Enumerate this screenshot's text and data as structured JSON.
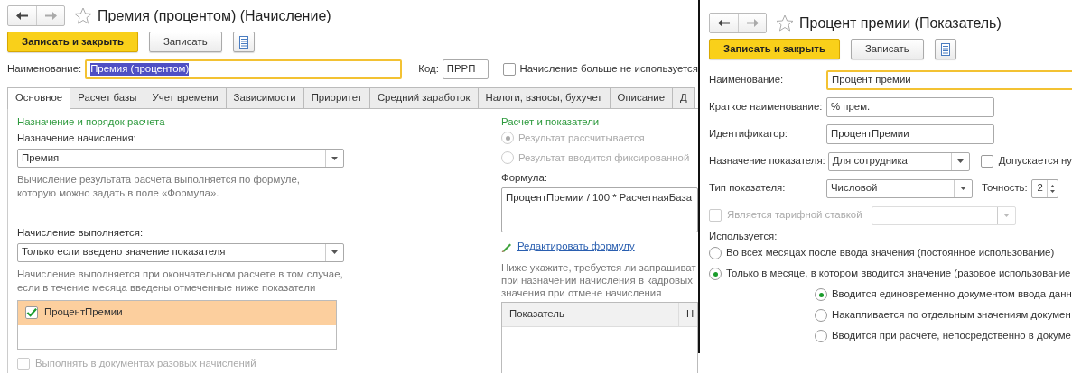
{
  "left_window": {
    "title": "Премия (процентом) (Начисление)",
    "favorite": false,
    "toolbar": [
      {
        "label": "Записать и закрыть",
        "kind": "primary"
      },
      {
        "label": "Записать",
        "kind": "default"
      },
      {
        "kind": "menu"
      }
    ],
    "name_field": {
      "label": "Наименование:",
      "value": "Премия (процентом)",
      "focused": true,
      "text_selected": true
    },
    "code_field": {
      "label": "Код:",
      "value": "ПРРП"
    },
    "discontinued": {
      "label": "Начисление больше не используется",
      "checked": false
    },
    "tabs": [
      {
        "label": "Основное",
        "selected": true
      },
      {
        "label": "Расчет базы",
        "selected": false
      },
      {
        "label": "Учет времени",
        "selected": false
      },
      {
        "label": "Зависимости",
        "selected": false
      },
      {
        "label": "Приоритет",
        "selected": false
      },
      {
        "label": "Средний заработок",
        "selected": false
      },
      {
        "label": "Налоги, взносы, бухучет",
        "selected": false
      },
      {
        "label": "Описание",
        "selected": false
      },
      {
        "label": "Д",
        "selected": false
      }
    ],
    "purpose_section": {
      "heading": "Назначение и порядок расчета",
      "purpose_label": "Назначение начисления:",
      "purpose_value": "Премия",
      "purpose_hint": [
        "Вычисление результата расчета выполняется по формуле,",
        "которую можно задать в поле «Формула»."
      ],
      "execution_label": "Начисление выполняется:",
      "execution_value": "Только если введено значение показателя",
      "execution_hint": [
        "Начисление выполняется при окончательном расчете в том случае,",
        "если в течение месяца введены отмеченные ниже показатели"
      ],
      "indicators": [
        {
          "label": "ПроцентПремии",
          "checked": true,
          "selected": true
        }
      ],
      "one_time": {
        "label": "Выполнять в документах разовых начислений",
        "checked": false,
        "disabled": true
      }
    },
    "calc_section": {
      "heading": "Расчет и показатели",
      "result_options": [
        {
          "label": "Результат рассчитывается",
          "selected": true,
          "disabled": true
        },
        {
          "label": "Результат вводится фиксированной",
          "selected": false,
          "disabled": true
        }
      ],
      "formula_label": "Формула:",
      "formula": "ПроцентПремии / 100 * РасчетнаяБаза",
      "edit_link": "Редактировать формулу",
      "request_hint": [
        "Ниже укажите, требуется ли запрашиват",
        "при назначении начисления в кадровых",
        "значения при отмене начисления"
      ],
      "table_columns": [
        "Показатель",
        "Н"
      ]
    }
  },
  "right_window": {
    "title": "Процент премии (Показатель)",
    "favorite": false,
    "toolbar": [
      {
        "label": "Записать и закрыть",
        "kind": "primary"
      },
      {
        "label": "Записать",
        "kind": "default"
      },
      {
        "kind": "menu"
      }
    ],
    "fields": [
      {
        "label": "Наименование:",
        "value": "Процент премии",
        "focused": true,
        "kind": "wide"
      },
      {
        "label": "Краткое наименование:",
        "value": "% прем.",
        "focused": false,
        "kind": "short"
      },
      {
        "label": "Идентификатор:",
        "value": "ПроцентПремии",
        "focused": false,
        "kind": "short"
      }
    ],
    "purpose": {
      "label": "Назначение показателя:",
      "value": "Для сотрудника"
    },
    "allow_zero": {
      "label": "Допускается ну",
      "checked": false
    },
    "type": {
      "label": "Тип показателя:",
      "value": "Числовой"
    },
    "precision": {
      "label": "Точность:",
      "value": "2"
    },
    "tariff": {
      "label": "Является тарифной ставкой",
      "checked": false,
      "disabled": true
    },
    "usage": {
      "label": "Используется:",
      "options": [
        {
          "label": "Во всех месяцах после ввода значения (постоянное использование)",
          "selected": false
        },
        {
          "label": "Только в месяце, в котором вводится значение (разовое использование",
          "selected": true,
          "children": [
            {
              "label": "Вводится единовременно документом ввода данн",
              "selected": true
            },
            {
              "label": "Накапливается по отдельным значениям докумен",
              "selected": false
            },
            {
              "label": "Вводится при расчете, непосредственно в докуме",
              "selected": false
            }
          ]
        }
      ]
    }
  }
}
